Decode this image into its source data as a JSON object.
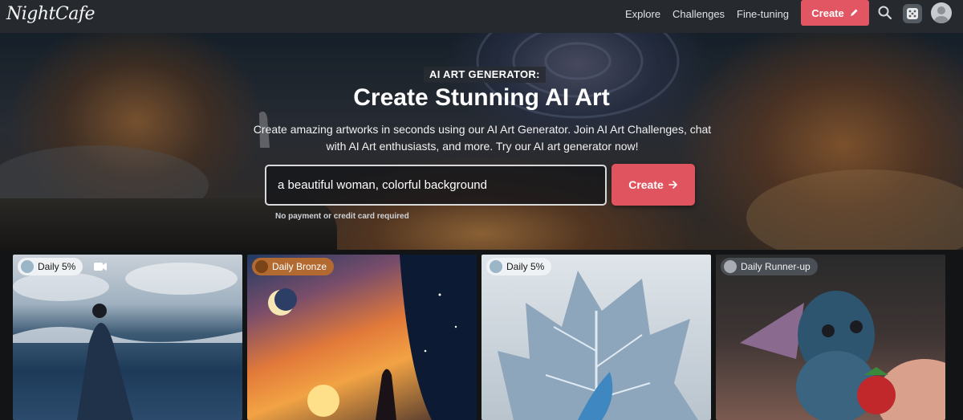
{
  "nav": {
    "logo": "NightCafe",
    "links": [
      "Explore",
      "Challenges",
      "Fine-tuning"
    ],
    "create_label": "Create",
    "icons": [
      "search-icon",
      "dice-icon",
      "avatar"
    ]
  },
  "hero": {
    "eyebrow": "AI ART GENERATOR:",
    "title": "Create Stunning AI Art",
    "subtitle": "Create amazing artworks in seconds using our AI Art Generator. Join AI Art Challenges, chat with AI Art enthusiasts, and more. Try our AI art generator now!",
    "prompt_value": "a beautiful woman, colorful background",
    "create_label": "Create",
    "hint": "No payment or credit card required"
  },
  "gallery": {
    "cards": [
      {
        "badge": "Daily 5%",
        "medal_icon": "robot-medal-icon",
        "has_video": true
      },
      {
        "badge": "Daily Bronze",
        "medal_icon": "bronze-medal-icon",
        "has_video": false
      },
      {
        "badge": "Daily 5%",
        "medal_icon": "robot-medal-icon",
        "has_video": false
      },
      {
        "badge": "Daily Runner-up",
        "medal_icon": "runner-up-medal-icon",
        "has_video": false
      }
    ]
  },
  "colors": {
    "accent": "#e25663",
    "nav_bg": "#262a2e",
    "bronze_badge": "#b36a30",
    "light_badge": "#e8edf0",
    "runnerup_badge": "#4a4f55"
  }
}
